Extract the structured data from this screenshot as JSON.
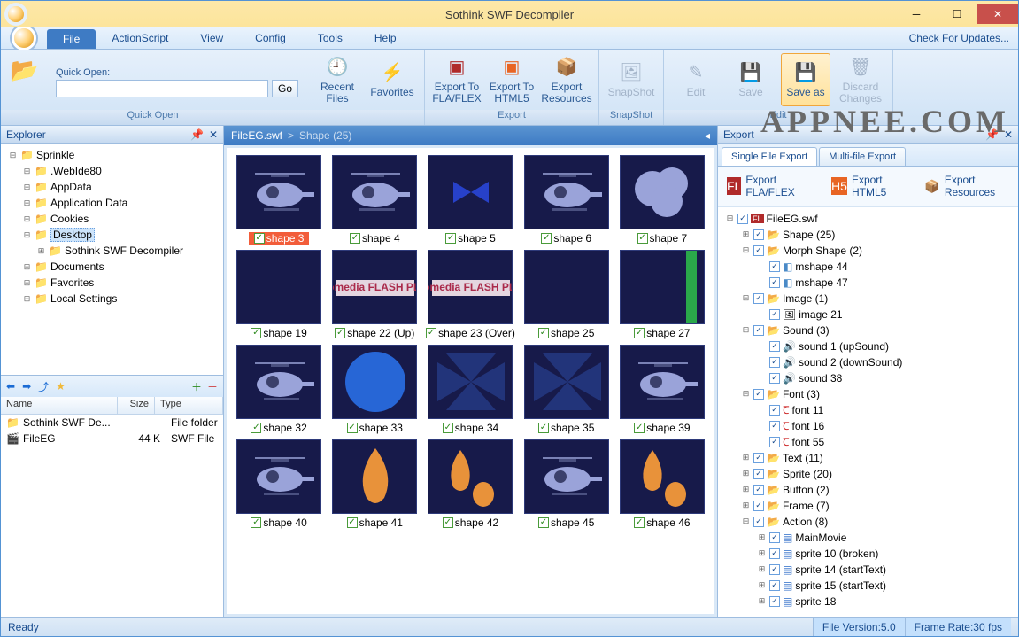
{
  "title": "Sothink SWF Decompiler",
  "menus": {
    "file": "File",
    "as": "ActionScript",
    "view": "View",
    "config": "Config",
    "tools": "Tools",
    "help": "Help",
    "updates": "Check For Updates..."
  },
  "ribbon": {
    "quickopen": {
      "label": "Quick Open:",
      "go": "Go",
      "group": "Quick Open"
    },
    "recent": "Recent Files",
    "fav": "Favorites",
    "export": {
      "fla": "Export To FLA/FLEX",
      "html5": "Export To HTML5",
      "res": "Export Resources",
      "group": "Export"
    },
    "snapshot": {
      "btn": "SnapShot",
      "group": "SnapShot"
    },
    "edit": {
      "edit": "Edit",
      "save": "Save",
      "saveas": "Save as",
      "discard": "Discard Changes",
      "group": "Edit"
    }
  },
  "watermark": "APPNEE.COM",
  "explorer": {
    "title": "Explorer",
    "items": [
      "Sprinkle",
      ".WebIde80",
      "AppData",
      "Application Data",
      "Cookies",
      "Desktop",
      "Sothink SWF Decompiler",
      "Documents",
      "Favorites",
      "Local Settings"
    ]
  },
  "filelist": {
    "cols": {
      "name": "Name",
      "size": "Size",
      "type": "Type"
    },
    "rows": [
      {
        "name": "Sothink SWF De...",
        "size": "",
        "type": "File folder"
      },
      {
        "name": "FileEG",
        "size": "44 K",
        "type": "SWF File"
      }
    ]
  },
  "breadcrumb": {
    "file": "FileEG.swf",
    "sep": ">",
    "cat": "Shape (25)"
  },
  "thumbs": [
    {
      "l": "shape 3",
      "sel": true,
      "k": "heli"
    },
    {
      "l": "shape 4",
      "k": "heli"
    },
    {
      "l": "shape 5",
      "k": "bow"
    },
    {
      "l": "shape 6",
      "k": "heli"
    },
    {
      "l": "shape 7",
      "k": "cloud"
    },
    {
      "l": "shape 19",
      "k": "blank"
    },
    {
      "l": "shape 22 (Up)",
      "k": "mm"
    },
    {
      "l": "shape 23 (Over)",
      "k": "mm"
    },
    {
      "l": "shape 25",
      "k": "blank"
    },
    {
      "l": "shape 27",
      "k": "green"
    },
    {
      "l": "shape 32",
      "k": "heli"
    },
    {
      "l": "shape 33",
      "k": "circle"
    },
    {
      "l": "shape 34",
      "k": "fan"
    },
    {
      "l": "shape 35",
      "k": "fan"
    },
    {
      "l": "shape 39",
      "k": "heli"
    },
    {
      "l": "shape 40",
      "k": "heli"
    },
    {
      "l": "shape 41",
      "k": "flame"
    },
    {
      "l": "shape 42",
      "k": "flame2"
    },
    {
      "l": "shape 45",
      "k": "heli"
    },
    {
      "l": "shape 46",
      "k": "flame2"
    }
  ],
  "exportPanel": {
    "title": "Export",
    "tabs": {
      "single": "Single File Export",
      "multi": "Multi-file Export"
    },
    "buttons": {
      "fla": "Export FLA/FLEX",
      "html5": "Export HTML5",
      "res": "Export Resources"
    },
    "tree": [
      {
        "d": 0,
        "tw": "-",
        "ic": "fl",
        "t": "FileEG.swf"
      },
      {
        "d": 1,
        "tw": "+",
        "ic": "fo",
        "t": "Shape (25)"
      },
      {
        "d": 1,
        "tw": "-",
        "ic": "fo",
        "t": "Morph Shape (2)"
      },
      {
        "d": 2,
        "tw": "",
        "ic": "ms",
        "t": "mshape 44"
      },
      {
        "d": 2,
        "tw": "",
        "ic": "ms",
        "t": "mshape 47"
      },
      {
        "d": 1,
        "tw": "-",
        "ic": "fo",
        "t": "Image (1)"
      },
      {
        "d": 2,
        "tw": "",
        "ic": "im",
        "t": "image 21"
      },
      {
        "d": 1,
        "tw": "-",
        "ic": "fo",
        "t": "Sound (3)"
      },
      {
        "d": 2,
        "tw": "",
        "ic": "sn",
        "t": "sound 1 (upSound)"
      },
      {
        "d": 2,
        "tw": "",
        "ic": "sn",
        "t": "sound 2 (downSound)"
      },
      {
        "d": 2,
        "tw": "",
        "ic": "sn",
        "t": "sound 38"
      },
      {
        "d": 1,
        "tw": "-",
        "ic": "fo",
        "t": "Font (3)"
      },
      {
        "d": 2,
        "tw": "",
        "ic": "ft",
        "t": "font 11"
      },
      {
        "d": 2,
        "tw": "",
        "ic": "ft",
        "t": "font 16"
      },
      {
        "d": 2,
        "tw": "",
        "ic": "ft",
        "t": "font 55"
      },
      {
        "d": 1,
        "tw": "+",
        "ic": "fo",
        "t": "Text (11)"
      },
      {
        "d": 1,
        "tw": "+",
        "ic": "fo",
        "t": "Sprite (20)"
      },
      {
        "d": 1,
        "tw": "+",
        "ic": "fo",
        "t": "Button (2)"
      },
      {
        "d": 1,
        "tw": "+",
        "ic": "fo",
        "t": "Frame (7)"
      },
      {
        "d": 1,
        "tw": "-",
        "ic": "fo",
        "t": "Action (8)"
      },
      {
        "d": 2,
        "tw": "+",
        "ic": "ac",
        "t": "MainMovie"
      },
      {
        "d": 2,
        "tw": "+",
        "ic": "ac",
        "t": "sprite 10 (broken)"
      },
      {
        "d": 2,
        "tw": "+",
        "ic": "ac",
        "t": "sprite 14 (startText)"
      },
      {
        "d": 2,
        "tw": "+",
        "ic": "ac",
        "t": "sprite 15 (startText)"
      },
      {
        "d": 2,
        "tw": "+",
        "ic": "ac",
        "t": "sprite 18"
      }
    ]
  },
  "status": {
    "ready": "Ready",
    "ver": "File Version:5.0",
    "fps": "Frame Rate:30 fps"
  }
}
